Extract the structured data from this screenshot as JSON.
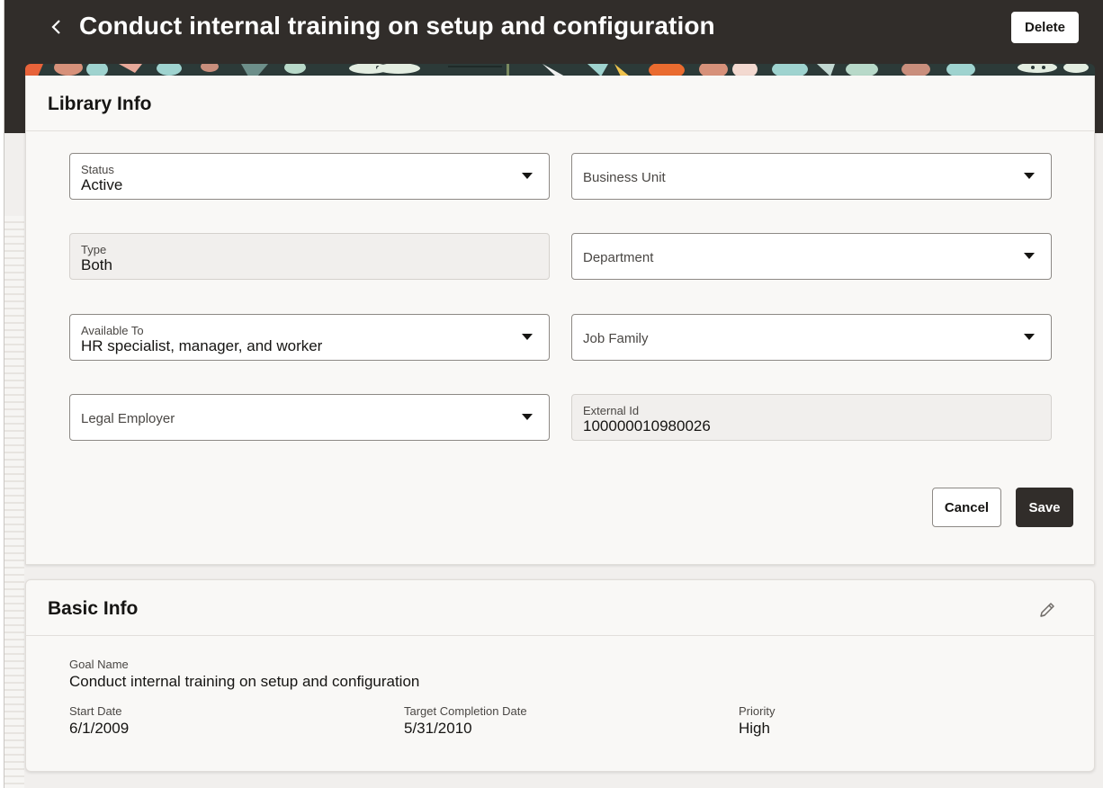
{
  "header": {
    "title": "Conduct internal training on setup and configuration",
    "delete_label": "Delete"
  },
  "library_info": {
    "title": "Library Info",
    "fields": {
      "status": {
        "label": "Status",
        "value": "Active"
      },
      "business_unit": {
        "label": "Business Unit"
      },
      "type": {
        "label": "Type",
        "value": "Both"
      },
      "department": {
        "label": "Department"
      },
      "available_to": {
        "label": "Available To",
        "value": "HR specialist, manager, and worker"
      },
      "job_family": {
        "label": "Job Family"
      },
      "legal_employer": {
        "label": "Legal Employer"
      },
      "external_id": {
        "label": "External Id",
        "value": "100000010980026"
      }
    },
    "cancel_label": "Cancel",
    "save_label": "Save"
  },
  "basic_info": {
    "title": "Basic Info",
    "goal_name": {
      "label": "Goal Name",
      "value": "Conduct internal training on setup and configuration"
    },
    "start_date": {
      "label": "Start Date",
      "value": "6/1/2009"
    },
    "target_completion_date": {
      "label": "Target Completion Date",
      "value": "5/31/2010"
    },
    "priority": {
      "label": "Priority",
      "value": "High"
    }
  },
  "icons": {
    "back": "chevron-left-icon",
    "edit": "pencil-icon",
    "dropdown": "caret-down-icon"
  },
  "colors": {
    "header_bg": "#312d2a",
    "page_bg": "#f1efed",
    "card_bg": "#f9f8f6",
    "save_bg": "#312d2a"
  }
}
